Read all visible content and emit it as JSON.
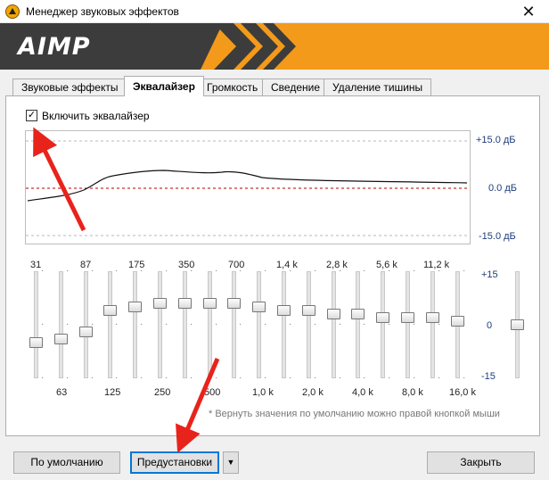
{
  "window": {
    "title": "Менеджер звуковых эффектов",
    "close_glyph": "✕"
  },
  "banner": {
    "logo_text": "AIMP",
    "color": "#f39a1a"
  },
  "tabs": [
    {
      "label": "Звуковые эффекты",
      "active": false
    },
    {
      "label": "Эквалайзер",
      "active": true
    },
    {
      "label": "Громкость",
      "active": false
    },
    {
      "label": "Сведение",
      "active": false
    },
    {
      "label": "Удаление тишины",
      "active": false
    }
  ],
  "equalizer": {
    "enable_checkbox": {
      "label": "Включить эквалайзер",
      "checked": true,
      "check_glyph": "✓"
    },
    "graph_scale": {
      "top": "+15.0 дБ",
      "middle": "0.0 дБ",
      "bottom": "-15.0 дБ"
    },
    "slider_scale": {
      "top": "+15",
      "middle": "0",
      "bottom": "-15"
    },
    "bands_top_labels": [
      "31",
      "87",
      "175",
      "350",
      "700",
      "1,4 k",
      "2,8 k",
      "5,6 k",
      "11,2 k"
    ],
    "bands_bottom_labels": [
      "63",
      "125",
      "250",
      "500",
      "1,0 k",
      "2,0 k",
      "4,0 k",
      "8,0 k",
      "16,0 k"
    ],
    "band_levels_db": [
      -5,
      -4,
      -2,
      4,
      5,
      6,
      6,
      6,
      6,
      5,
      4,
      4,
      3,
      3,
      2,
      2,
      2,
      1
    ],
    "preamp_level_db": 0,
    "hint": "* Вернуть значения по умолчанию можно правой кнопкой мыши"
  },
  "footer": {
    "defaults_label": "По умолчанию",
    "presets_label": "Предустановки",
    "presets_dropdown_glyph": "▼",
    "close_label": "Закрыть"
  },
  "annotations": {
    "arrow_color": "#e8231b"
  }
}
